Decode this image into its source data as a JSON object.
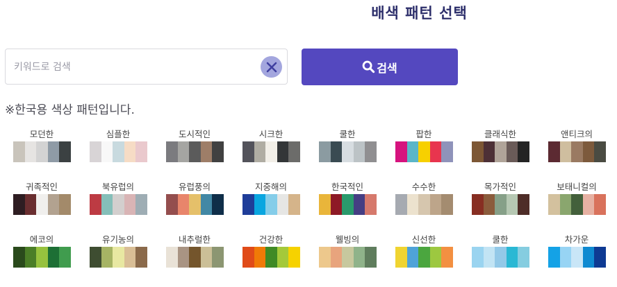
{
  "header": {
    "title": "배색 패턴 선택"
  },
  "search": {
    "placeholder": "키워드로 검색",
    "value": "",
    "button_label": "검색"
  },
  "subtitle": "※한국용 색상 패턴입니다.",
  "patterns": [
    {
      "name": "모던한",
      "colors": [
        "#c9c4bb",
        "#e6e4e2",
        "#d3d3d3",
        "#8f9ba6",
        "#3b4142"
      ]
    },
    {
      "name": "심플한",
      "colors": [
        "#d8d4d6",
        "#f8f8f8",
        "#c8dadf",
        "#f6dcc5",
        "#eac9cd"
      ]
    },
    {
      "name": "도시적인",
      "colors": [
        "#7b7b7f",
        "#a5a5a2",
        "#5b5b5b",
        "#9e7e68",
        "#414141"
      ]
    },
    {
      "name": "시크한",
      "colors": [
        "#53535b",
        "#b0ada3",
        "#f2efe8",
        "#333638",
        "#6c6c6a"
      ]
    },
    {
      "name": "쿨한",
      "colors": [
        "#8b9ba1",
        "#3a4b52",
        "#d7dde1",
        "#bcc3c6",
        "#908f91"
      ]
    },
    {
      "name": "팝한",
      "colors": [
        "#d6137e",
        "#5bb6c8",
        "#f7d000",
        "#e8354e",
        "#8f93ba"
      ]
    },
    {
      "name": "클래식한",
      "colors": [
        "#7d5735",
        "#4d3036",
        "#b0a499",
        "#6a5b58",
        "#242424"
      ]
    },
    {
      "name": "앤티크의",
      "colors": [
        "#5c2a32",
        "#cfbe9f",
        "#9a7a62",
        "#7d5a3c",
        "#4a4b42"
      ]
    },
    {
      "name": "귀족적인",
      "colors": [
        "#2e1d22",
        "#6a2e30",
        "#f0efed",
        "#b2a290",
        "#a38a6a"
      ]
    },
    {
      "name": "북유럽의",
      "colors": [
        "#bd3b43",
        "#85bfb9",
        "#d3cfce",
        "#d9b4b5",
        "#9eadb4"
      ]
    },
    {
      "name": "유럽풍의",
      "colors": [
        "#944e4e",
        "#e8856b",
        "#e5c06a",
        "#4288a5",
        "#0f2e49"
      ]
    },
    {
      "name": "지중해의",
      "colors": [
        "#1f3d99",
        "#0aa6e0",
        "#85cde9",
        "#e6e6e4",
        "#d5b48a"
      ]
    },
    {
      "name": "한국적인",
      "colors": [
        "#e9b53a",
        "#8e1a26",
        "#2a9a6c",
        "#453e83",
        "#d6796c"
      ]
    },
    {
      "name": "수수한",
      "colors": [
        "#a6aab1",
        "#ece2ce",
        "#d6c6ae",
        "#bda58a",
        "#a48c70"
      ]
    },
    {
      "name": "목가적인",
      "colors": [
        "#872e22",
        "#8b5c3c",
        "#86a088",
        "#b6c8b3",
        "#4e2d28"
      ]
    },
    {
      "name": "보태니컬의",
      "colors": [
        "#d3c19e",
        "#8aa66e",
        "#43603b",
        "#e6b1a3",
        "#d9725c"
      ]
    },
    {
      "name": "에코의",
      "colors": [
        "#2a4a1c",
        "#4b7e27",
        "#97c23e",
        "#1d6f35",
        "#409c4e"
      ]
    },
    {
      "name": "유기농의",
      "colors": [
        "#3e4d31",
        "#a6b464",
        "#e8e8a2",
        "#d9be96",
        "#8b6a4b"
      ]
    },
    {
      "name": "내추럴한",
      "colors": [
        "#e9e2d7",
        "#a99483",
        "#74552c",
        "#cbbf97",
        "#8c9672"
      ]
    },
    {
      "name": "건강한",
      "colors": [
        "#e04b19",
        "#f07a07",
        "#3f8a25",
        "#a4c93a",
        "#f6d200"
      ]
    },
    {
      "name": "웰빙의",
      "colors": [
        "#edc88c",
        "#e8a47d",
        "#c7c89e",
        "#8fb38a",
        "#5f7d5d"
      ]
    },
    {
      "name": "신선한",
      "colors": [
        "#f0d431",
        "#4fa3d8",
        "#4ba63f",
        "#9dc840",
        "#f39041"
      ]
    },
    {
      "name": "쿨한",
      "colors": [
        "#9ad4f0",
        "#c2e4f4",
        "#93c9e8",
        "#2ab8d4",
        "#85cde0"
      ]
    },
    {
      "name": "차가운",
      "colors": [
        "#14a2e6",
        "#97d4f4",
        "#c9e6f7",
        "#0f8ad1",
        "#0e3a93"
      ]
    }
  ]
}
